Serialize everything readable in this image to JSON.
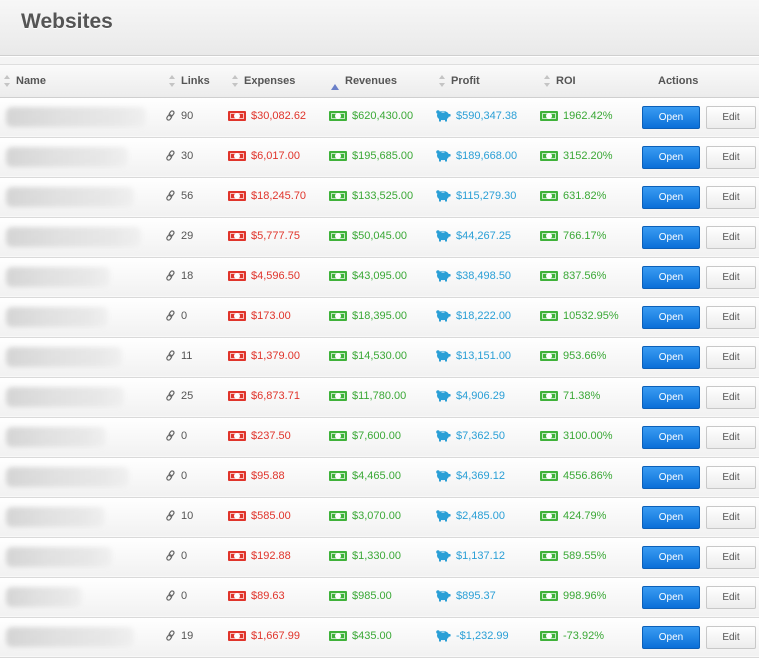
{
  "page": {
    "title": "Websites"
  },
  "colors": {
    "expense": "#e0342b",
    "revenue": "#3aa836",
    "profit": "#2a9fd6",
    "open_button": "#0a6fd8"
  },
  "columns": {
    "name": "Name",
    "links": "Links",
    "expenses": "Expenses",
    "revenues": "Revenues",
    "profit": "Profit",
    "roi": "ROI",
    "actions": "Actions"
  },
  "actions": {
    "open": "Open",
    "edit": "Edit"
  },
  "rows": [
    {
      "links": "90",
      "expenses": "$30,082.62",
      "revenues": "$620,430.00",
      "profit": "$590,347.38",
      "roi": "1962.42%"
    },
    {
      "links": "30",
      "expenses": "$6,017.00",
      "revenues": "$195,685.00",
      "profit": "$189,668.00",
      "roi": "3152.20%"
    },
    {
      "links": "56",
      "expenses": "$18,245.70",
      "revenues": "$133,525.00",
      "profit": "$115,279.30",
      "roi": "631.82%"
    },
    {
      "links": "29",
      "expenses": "$5,777.75",
      "revenues": "$50,045.00",
      "profit": "$44,267.25",
      "roi": "766.17%"
    },
    {
      "links": "18",
      "expenses": "$4,596.50",
      "revenues": "$43,095.00",
      "profit": "$38,498.50",
      "roi": "837.56%"
    },
    {
      "links": "0",
      "expenses": "$173.00",
      "revenues": "$18,395.00",
      "profit": "$18,222.00",
      "roi": "10532.95%"
    },
    {
      "links": "11",
      "expenses": "$1,379.00",
      "revenues": "$14,530.00",
      "profit": "$13,151.00",
      "roi": "953.66%"
    },
    {
      "links": "25",
      "expenses": "$6,873.71",
      "revenues": "$11,780.00",
      "profit": "$4,906.29",
      "roi": "71.38%"
    },
    {
      "links": "0",
      "expenses": "$237.50",
      "revenues": "$7,600.00",
      "profit": "$7,362.50",
      "roi": "3100.00%"
    },
    {
      "links": "0",
      "expenses": "$95.88",
      "revenues": "$4,465.00",
      "profit": "$4,369.12",
      "roi": "4556.86%"
    },
    {
      "links": "10",
      "expenses": "$585.00",
      "revenues": "$3,070.00",
      "profit": "$2,485.00",
      "roi": "424.79%"
    },
    {
      "links": "0",
      "expenses": "$192.88",
      "revenues": "$1,330.00",
      "profit": "$1,137.12",
      "roi": "589.55%"
    },
    {
      "links": "0",
      "expenses": "$89.63",
      "revenues": "$985.00",
      "profit": "$895.37",
      "roi": "998.96%"
    },
    {
      "links": "19",
      "expenses": "$1,667.99",
      "revenues": "$435.00",
      "profit": "-$1,232.99",
      "roi": "-73.92%"
    }
  ]
}
